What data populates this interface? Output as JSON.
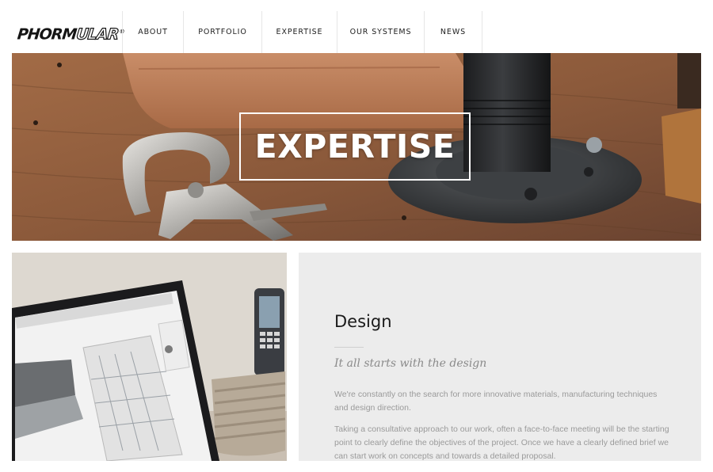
{
  "header": {
    "logo_text_solid": "PHORM",
    "logo_text_outline": "ULAR",
    "logo_mark": "®",
    "nav": [
      {
        "label": "ABOUT"
      },
      {
        "label": "PORTFOLIO"
      },
      {
        "label": "EXPERTISE"
      },
      {
        "label": "OUR SYSTEMS"
      },
      {
        "label": "NEWS"
      }
    ]
  },
  "hero": {
    "title": "EXPERTISE"
  },
  "section": {
    "title": "Design",
    "subtitle": "It all starts with the design",
    "paragraph1": "We're constantly on the search for more innovative materials, manufacturing techniques and design direction.",
    "paragraph2": "Taking a consultative approach to our work, often a face-to-face meeting will be the starting point to clearly define the objectives of the project. Once we have a clearly defined brief we can start work on concepts and towards a detailed proposal."
  },
  "colors": {
    "background": "#ffffff",
    "panel": "#ececec",
    "nav_border": "#e6e6e6",
    "text_dark": "#1a1a1a",
    "text_muted": "#9a9a9a"
  }
}
